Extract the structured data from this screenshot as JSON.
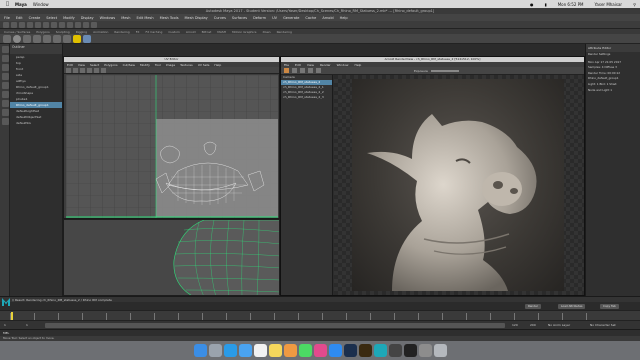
{
  "mac_menubar": {
    "apple": "",
    "app": "Maya",
    "menu": "Window",
    "status_time": "Mon 6:52 PM",
    "user": "Yaser Mhaisar"
  },
  "app_title": "Autodesk Maya 2017 - Student Version: /Users/Yaser/Desktop/Ch_Scenes/Ch_Rhino_RM_Statuess_2.mb* --- [Rhino_default_group1]",
  "maya_menu": [
    "File",
    "Edit",
    "Create",
    "Select",
    "Modify",
    "Display",
    "Windows",
    "Mesh",
    "Edit Mesh",
    "Mesh Tools",
    "Mesh Display",
    "Curves",
    "Surfaces",
    "Deform",
    "UV",
    "Generate",
    "Cache",
    "Arnold",
    "Help"
  ],
  "shelf_tabs": [
    "Curves / Surfaces",
    "Polygons",
    "Sculpting",
    "Rigging",
    "Animation",
    "Rendering",
    "FX",
    "FX Caching",
    "Custom",
    "Arnold",
    "Bifrost",
    "MASH",
    "Motion Graphics",
    "XGen",
    "Rendering"
  ],
  "outliner": {
    "title": "Outliner",
    "menus": [
      "Display",
      "Show",
      "Help"
    ],
    "items": [
      "persp",
      "top",
      "front",
      "side",
      "aiPhys",
      "Rhino_default_group1",
      "rhinoShape",
      "pCube1",
      "Rhino_default_group1",
      "defaultLightSet",
      "defaultObjectSet",
      "defaultSG"
    ]
  },
  "uv_editor": {
    "title": "UV Editor",
    "menus": [
      "Edit",
      "View",
      "Select",
      "Polygons",
      "Cut/Sew",
      "Modify",
      "Tool",
      "Image",
      "Textures",
      "UV Sets",
      "Help"
    ]
  },
  "viewport": {
    "label": ""
  },
  "render_view": {
    "title": "Arnold RenderView - ch_Rhino_RM_statuess_2 [512x512, 100%]",
    "menus": [
      "File",
      "Edit",
      "View",
      "Render",
      "Window",
      "Help"
    ],
    "side_items": [
      "Camera",
      "ch_Rhino_RM_statuess_2",
      "ch_Rhino_RM_statuess_2_1",
      "ch_Rhino_RM_statuess_2_2",
      "ch_Rhino_RM_statuess_2_3"
    ],
    "exposure_label": "Exposure"
  },
  "attr_editor": {
    "title": "Attribute Editor",
    "lines": [
      "Render Settings",
      "",
      "Mon Apr 17 21:05 2017",
      "Samples: 4 Diffuse 3",
      "Render Time: 00:00:12",
      "Rhino_default_group1",
      "Light: 1 Bkd: 1 Shad:",
      "Node and Light 1"
    ]
  },
  "script_line": "// Result: Rendering ch_Rhino_RM_statuess_2 / Rhino RM complete",
  "timeslider": {
    "start": "1",
    "end": "120",
    "current": "1",
    "range_end": "200",
    "char_set": "No Character Set",
    "anim_layer": "No Anim Layer",
    "fps": "24 fps"
  },
  "cmdline": {
    "label": "MEL",
    "text": ""
  },
  "helpline": "Move Tool: Select an object to move.",
  "buttons": {
    "render": "Render",
    "load_attrs": "Load Attributes",
    "copy_tab": "Copy Tab"
  },
  "colors": {
    "selection": "#5285a6",
    "uv_wire": "#f0f0f0",
    "viewport_wire": "#2ee07a",
    "sculpture": "#c9c2b7"
  },
  "icons": [
    "apple-icon",
    "wifi-icon",
    "battery-icon",
    "search-icon",
    "maya-logo-icon"
  ]
}
